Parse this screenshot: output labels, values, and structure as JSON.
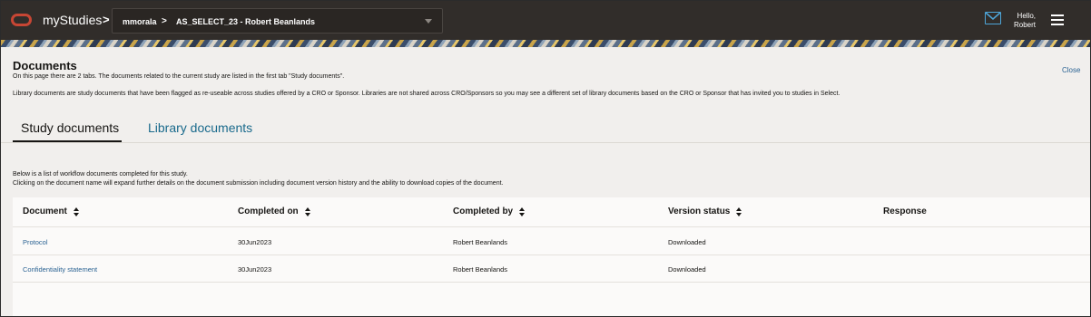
{
  "header": {
    "app_title": "myStudies",
    "crumb_separator": ">",
    "user": "mmorala",
    "study_separator": ">",
    "study": "AS_SELECT_23 - Robert Beanlands",
    "greeting_line1": "Hello,",
    "greeting_line2": "Robert"
  },
  "page": {
    "title": "Documents",
    "close_label": "Close",
    "intro": "On this page there are 2 tabs. The documents related to the current study are listed in the first tab \"Study documents\".",
    "library_note": "Library documents are study documents that have been flagged as re-useable across studies offered by a CRO or Sponsor. Libraries are not shared across CRO/Sponsors so you may see a different set of library documents based on the CRO or Sponsor that has invited you to studies in Select."
  },
  "tabs": [
    {
      "label": "Study documents",
      "selected": true
    },
    {
      "label": "Library documents",
      "selected": false
    }
  ],
  "content": {
    "description_line1": "Below is a list of workflow documents completed for this study.",
    "description_line2": "Clicking on the document name will expand further details on the document submission including document version history and the ability to download copies of the document."
  },
  "table": {
    "columns": [
      "Document",
      "Completed on",
      "Completed by",
      "Version status",
      "Response"
    ],
    "rows": [
      {
        "document": "Protocol",
        "completed_on": "30Jun2023",
        "completed_by": "Robert Beanlands",
        "version_status": "Downloaded",
        "response": ""
      },
      {
        "document": "Confidentiality statement",
        "completed_on": "30Jun2023",
        "completed_by": "Robert Beanlands",
        "version_status": "Downloaded",
        "response": ""
      }
    ]
  },
  "colors": {
    "topbar": "#312d2a",
    "accent_link": "#2b6393",
    "brand_red": "#c74634",
    "mail_blue": "#4ea6d9"
  },
  "icons": [
    "oracle-logo-icon",
    "chevron-down-icon",
    "mail-icon",
    "hamburger-menu-icon",
    "sort-icon"
  ]
}
